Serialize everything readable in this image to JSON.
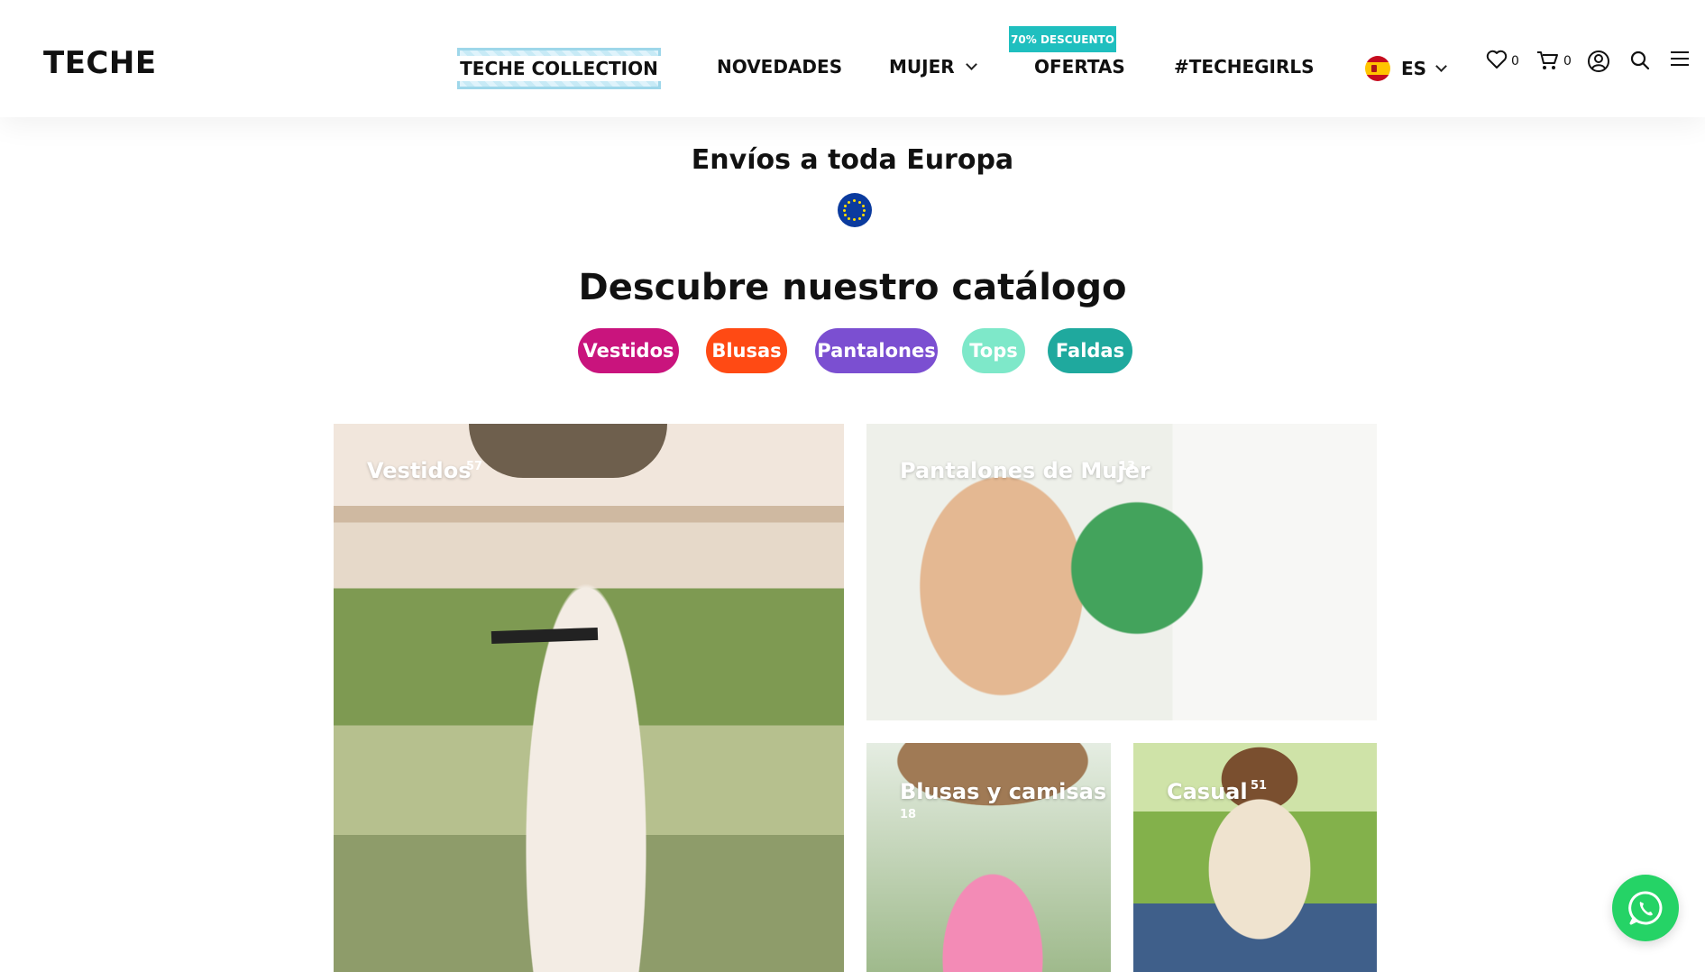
{
  "header": {
    "logo": "TECHE",
    "nav": {
      "collection": "TECHE COLLECTION",
      "novedades": "NOVEDADES",
      "mujer": "MUJER",
      "ofertas": "OFERTAS",
      "ofertas_badge": "70% DESCUENTO",
      "techegirls": "#TECHEGIRLS"
    },
    "language": {
      "code": "ES",
      "flag_icon": "spain-flag-icon"
    },
    "wishlist_count": "0",
    "cart_count": "0"
  },
  "shipping": {
    "text": "Envíos a toda Europa",
    "icon": "eu-flag-icon"
  },
  "catalog": {
    "title": "Descubre nuestro catálogo",
    "pills": [
      {
        "label": "Vestidos",
        "color": "#c9147d"
      },
      {
        "label": "Blusas",
        "color": "#ff4a14"
      },
      {
        "label": "Pantalones",
        "color": "#7b4fd1"
      },
      {
        "label": "Tops",
        "color": "#7ee8c9"
      },
      {
        "label": "Faldas",
        "color": "#1fa99e"
      }
    ],
    "tiles": [
      {
        "label": "Vestidos",
        "count": "57"
      },
      {
        "label": "Pantalones de Mujer",
        "count": "13"
      },
      {
        "label": "Blusas y camisas",
        "count": "18"
      },
      {
        "label": "Casual",
        "count": "51"
      }
    ]
  },
  "colors": {
    "accent_teal": "#1fbfbf",
    "whatsapp": "#25d366"
  }
}
